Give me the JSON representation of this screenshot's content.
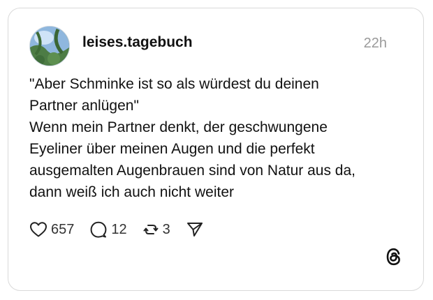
{
  "post": {
    "username": "leises.tagebuch",
    "time": "22h",
    "text": "\"Aber Schminke ist so als würdest du deinen\nPartner anlügen\"\nWenn mein Partner denkt, der geschwungene\nEyeliner  über meinen Augen und die perfekt\nausgemalten Augenbrauen sind von Natur aus da,\ndann weiß ich auch nicht weiter",
    "likes": "657",
    "replies": "12",
    "reposts": "3"
  },
  "icons": {
    "like": "heart-icon",
    "reply": "speech-bubble-icon",
    "repost": "repost-icon",
    "share": "send-icon",
    "brand": "threads-logo-icon"
  },
  "colors": {
    "text": "#111111",
    "muted": "#9a9a9a",
    "border": "#d9d9d9"
  }
}
